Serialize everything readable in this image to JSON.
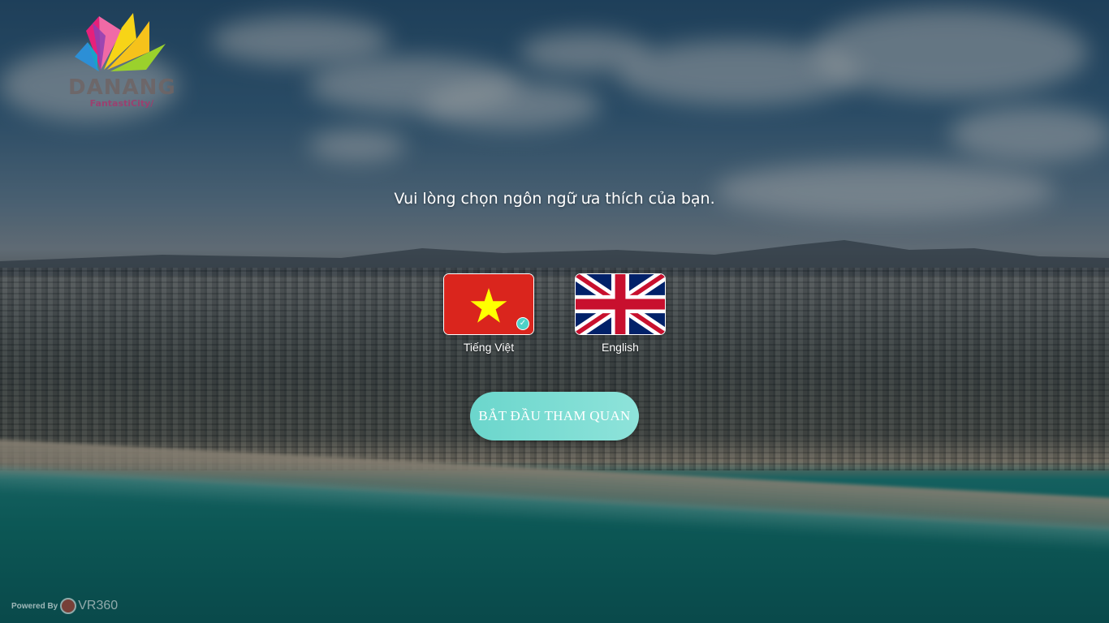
{
  "logo": {
    "name": "DANANG",
    "tagline": "FantastiCity/"
  },
  "prompt": "Vui lòng chọn ngôn ngữ ưa thích của bạn.",
  "languages": [
    {
      "label": "Tiếng Việt",
      "flag": "vietnam-flag-icon",
      "selected": true
    },
    {
      "label": "English",
      "flag": "united-kingdom-flag-icon",
      "selected": false
    }
  ],
  "start_button": "BẮT ĐẦU THAM QUAN",
  "footer": {
    "powered_by": "Powered By",
    "brand": "VR360"
  },
  "colors": {
    "button_gradient_start": "#6bd6cc",
    "button_gradient_end": "#8ee3da",
    "vietnam_red": "#da251d",
    "vietnam_star": "#ffff00",
    "uk_blue": "#012169",
    "uk_red": "#c8102e",
    "check_badge": "#4fd1c8"
  }
}
